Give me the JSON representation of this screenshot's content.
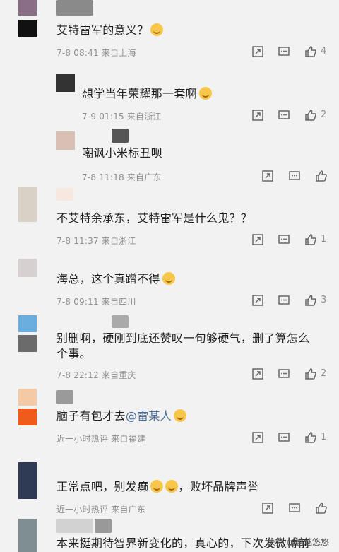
{
  "comments": [
    {
      "text": "艾特雷军的意义？",
      "meta": "7-8 08:41  来自上海",
      "likes": "4",
      "has_emoji": true
    },
    {
      "text": "想学当年荣耀那一套啊",
      "meta": "7-9 01:15  来自浙江",
      "likes": "2",
      "has_emoji": true
    },
    {
      "text": "嘲讽小米标丑呗",
      "meta": "7-8 11:18  来自广东",
      "likes": "",
      "has_emoji": false
    },
    {
      "text": "不艾特余承东，艾特雷军是什么鬼？？",
      "meta": "7-8 11:37  来自浙江",
      "likes": "1",
      "has_emoji": false
    },
    {
      "text": "海总，这个真蹭不得",
      "meta": "7-8 09:11  来自四川",
      "likes": "3",
      "has_emoji": true
    },
    {
      "text_line1": "别删啊，硬刚到底还赞叹一句够硬气，删了算怎么",
      "text_line2": "个事。",
      "meta": "7-8 22:12  来自重庆",
      "likes": "2"
    },
    {
      "text_prefix": "脑子有包才去",
      "mention": "@雷某人",
      "meta": "近一小时热评  来自福建",
      "likes": "1"
    },
    {
      "text_prefix": "正常点吧，别发癫",
      "text_suffix": "，败坏品牌声誉",
      "meta": "近一小时热评  来自广东",
      "likes": ""
    },
    {
      "text": "本来挺期待智界新变化的，真心的，下次发微博前"
    }
  ],
  "watermark": "头条 @魑魅悠悠",
  "colors": {
    "meta": "#8e8e8e",
    "mention": "#4a6c9a",
    "emoji": "#f6c74a"
  },
  "icons": [
    "share-icon",
    "comment-icon",
    "like-icon"
  ]
}
